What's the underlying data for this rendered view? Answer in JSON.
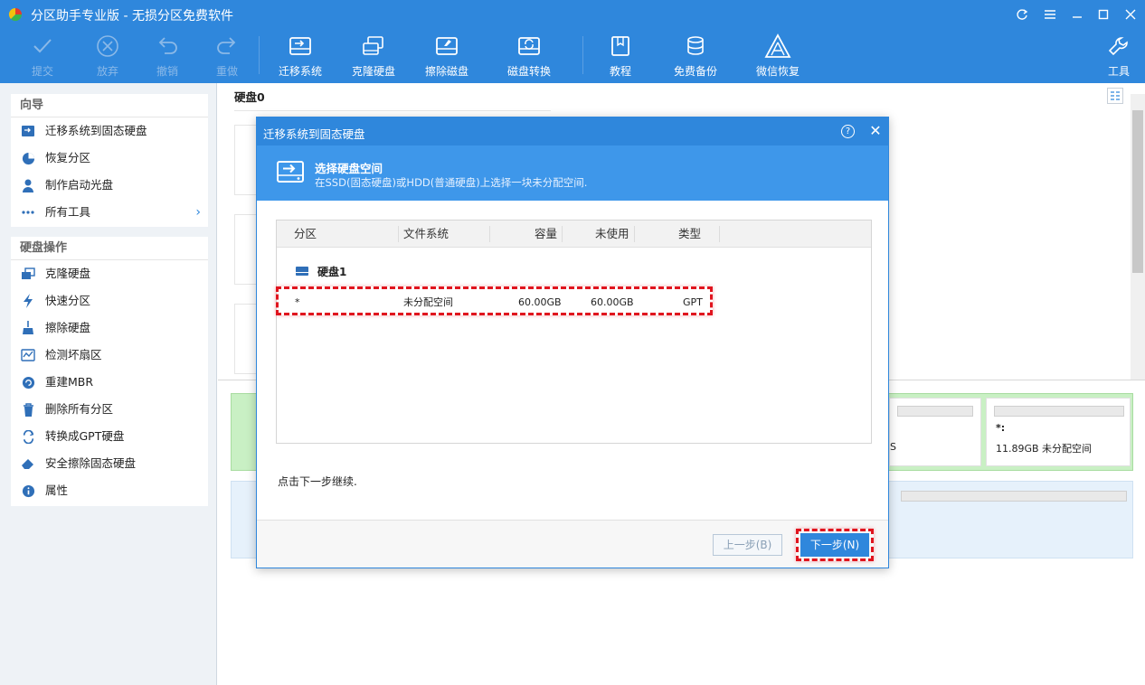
{
  "window": {
    "title": "分区助手专业版 - 无损分区免费软件"
  },
  "toolbar": {
    "commit": "提交",
    "discard": "放弃",
    "undo": "撤销",
    "redo": "重做",
    "migrate_os": "迁移系统",
    "clone_disk": "克隆硬盘",
    "wipe_disk": "擦除磁盘",
    "disk_convert": "磁盘转换",
    "tutorial": "教程",
    "free_backup": "免费备份",
    "wechat_recovery": "微信恢复",
    "tools": "工具"
  },
  "sidebar": {
    "wizard_title": "向导",
    "wizard_items": [
      {
        "label": "迁移系统到固态硬盘",
        "icon": "migrate-icon"
      },
      {
        "label": "恢复分区",
        "icon": "pie-icon"
      },
      {
        "label": "制作启动光盘",
        "icon": "person-icon"
      },
      {
        "label": "所有工具",
        "icon": "dots-icon"
      }
    ],
    "disk_ops_title": "硬盘操作",
    "disk_ops_items": [
      {
        "label": "克隆硬盘",
        "icon": "clone-icon"
      },
      {
        "label": "快速分区",
        "icon": "lightning-icon"
      },
      {
        "label": "擦除硬盘",
        "icon": "broom-icon"
      },
      {
        "label": "检测坏扇区",
        "icon": "scan-icon"
      },
      {
        "label": "重建MBR",
        "icon": "rebuild-icon"
      },
      {
        "label": "删除所有分区",
        "icon": "trash-icon"
      },
      {
        "label": "转换成GPT硬盘",
        "icon": "convert-icon"
      },
      {
        "label": "安全擦除固态硬盘",
        "icon": "eraser-icon"
      },
      {
        "label": "属性",
        "icon": "info-icon"
      }
    ]
  },
  "main": {
    "disk0_label": "硬盘0",
    "right_cell": {
      "name": "*:",
      "info": "11.89GB 未分配空间"
    },
    "partial_s": "S"
  },
  "dialog": {
    "title": "迁移系统到固态硬盘",
    "banner_heading": "选择硬盘空间",
    "banner_sub": "在SSD(固态硬盘)或HDD(普通硬盘)上选择一块未分配空间.",
    "columns": {
      "partition": "分区",
      "filesystem": "文件系统",
      "capacity": "容量",
      "unused": "未使用",
      "type": "类型"
    },
    "disk_name": "硬盘1",
    "row": {
      "partition": "*",
      "filesystem": "未分配空间",
      "capacity": "60.00GB",
      "unused": "60.00GB",
      "type": "GPT"
    },
    "instruction": "点击下一步继续.",
    "prev_button": "上一步(B)",
    "next_button": "下一步(N)"
  },
  "colors": {
    "accent": "#2f87dc",
    "highlight": "#e0141e",
    "disk_row_green": "#c9f0c4"
  }
}
